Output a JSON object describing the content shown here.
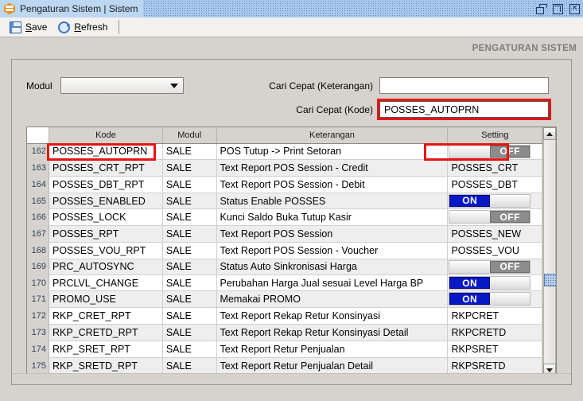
{
  "window": {
    "title": "Pengaturan Sistem | Sistem",
    "app_icon": "hexagon-app-icon",
    "controls": {
      "restore": "restore-icon",
      "maximize": "maximize-icon",
      "close": "close-icon"
    }
  },
  "toolbar": {
    "save_label": "Save",
    "save_mnemonic": "S",
    "save_rest": "ave",
    "refresh_label": "Refresh",
    "refresh_mnemonic": "R",
    "refresh_rest": "efresh"
  },
  "page": {
    "heading": "PENGATURAN SISTEM"
  },
  "form": {
    "modul_label": "Modul",
    "modul_value": "",
    "cari_keterangan_label": "Cari Cepat (Keterangan)",
    "cari_keterangan_value": "",
    "cari_kode_label": "Cari Cepat (Kode)",
    "cari_kode_value": "POSSES_AUTOPRN"
  },
  "table": {
    "headers": {
      "index": "",
      "kode": "Kode",
      "modul": "Modul",
      "keterangan": "Keterangan",
      "setting": "Setting"
    },
    "toggle_on_label": "ON",
    "toggle_off_label": "OFF",
    "rows": [
      {
        "index": "162",
        "kode": "POSSES_AUTOPRN",
        "modul": "SALE",
        "keterangan": "POS Tutup -> Print Setoran",
        "setting_type": "toggle",
        "setting": "OFF"
      },
      {
        "index": "163",
        "kode": "POSSES_CRT_RPT",
        "modul": "SALE",
        "keterangan": "Text Report POS Session - Credit",
        "setting_type": "text",
        "setting": "POSSES_CRT"
      },
      {
        "index": "164",
        "kode": "POSSES_DBT_RPT",
        "modul": "SALE",
        "keterangan": "Text Report POS Session - Debit",
        "setting_type": "text",
        "setting": "POSSES_DBT"
      },
      {
        "index": "165",
        "kode": "POSSES_ENABLED",
        "modul": "SALE",
        "keterangan": "Status Enable POSSES",
        "setting_type": "toggle",
        "setting": "ON"
      },
      {
        "index": "166",
        "kode": "POSSES_LOCK",
        "modul": "SALE",
        "keterangan": "Kunci Saldo Buka Tutup Kasir",
        "setting_type": "toggle",
        "setting": "OFF"
      },
      {
        "index": "167",
        "kode": "POSSES_RPT",
        "modul": "SALE",
        "keterangan": "Text Report POS Session",
        "setting_type": "text",
        "setting": "POSSES_NEW"
      },
      {
        "index": "168",
        "kode": "POSSES_VOU_RPT",
        "modul": "SALE",
        "keterangan": "Text Report POS Session - Voucher",
        "setting_type": "text",
        "setting": "POSSES_VOU"
      },
      {
        "index": "169",
        "kode": "PRC_AUTOSYNC",
        "modul": "SALE",
        "keterangan": "Status Auto Sinkronisasi Harga",
        "setting_type": "toggle",
        "setting": "OFF"
      },
      {
        "index": "170",
        "kode": "PRCLVL_CHANGE",
        "modul": "SALE",
        "keterangan": "Perubahan Harga Jual sesuai Level Harga BP",
        "setting_type": "toggle",
        "setting": "ON"
      },
      {
        "index": "171",
        "kode": "PROMO_USE",
        "modul": "SALE",
        "keterangan": "Memakai PROMO",
        "setting_type": "toggle",
        "setting": "ON"
      },
      {
        "index": "172",
        "kode": "RKP_CRET_RPT",
        "modul": "SALE",
        "keterangan": "Text Report Rekap Retur Konsinyasi",
        "setting_type": "text",
        "setting": "RKPCRET"
      },
      {
        "index": "173",
        "kode": "RKP_CRETD_RPT",
        "modul": "SALE",
        "keterangan": "Text Report Rekap Retur Konsinyasi Detail",
        "setting_type": "text",
        "setting": "RKPCRETD"
      },
      {
        "index": "174",
        "kode": "RKP_SRET_RPT",
        "modul": "SALE",
        "keterangan": "Text Report Retur Penjualan",
        "setting_type": "text",
        "setting": "RKPSRET"
      },
      {
        "index": "175",
        "kode": "RKP_SRETD_RPT",
        "modul": "SALE",
        "keterangan": "Text Report Retur Penjualan Detail",
        "setting_type": "text",
        "setting": "RKPSRETD"
      }
    ],
    "highlighted_row_index": "162"
  },
  "colors": {
    "highlight_red": "#e81313",
    "toggle_on_blue": "#0718c4",
    "toggle_off_gray": "#8c8c8c",
    "titlebar_blue": "#a8c8ec",
    "panel_gray": "#d6d3ce"
  }
}
